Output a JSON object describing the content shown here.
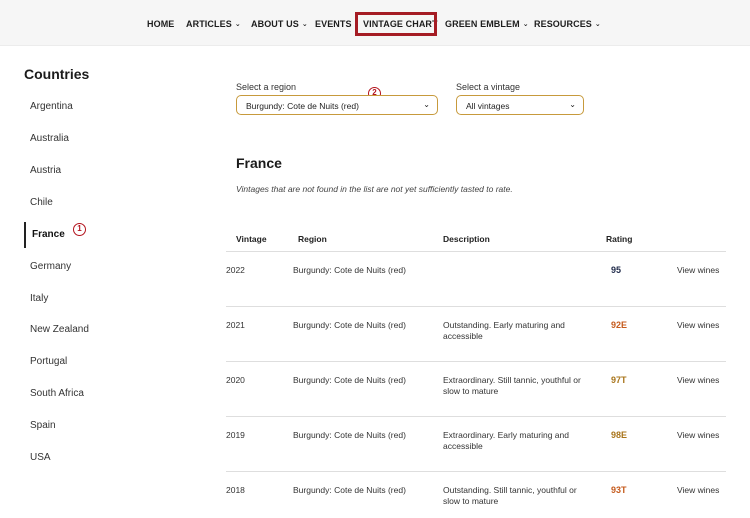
{
  "nav": {
    "items": [
      {
        "label": "HOME",
        "dropdown": false
      },
      {
        "label": "ARTICLES",
        "dropdown": true
      },
      {
        "label": "ABOUT US",
        "dropdown": true
      },
      {
        "label": "EVENTS",
        "dropdown": false
      },
      {
        "label": "VINTAGE CHART",
        "dropdown": false
      },
      {
        "label": "GREEN EMBLEM",
        "dropdown": true
      },
      {
        "label": "RESOURCES",
        "dropdown": true
      }
    ],
    "highlight_color": "#a51c24"
  },
  "sidebar": {
    "title": "Countries",
    "items": [
      "Argentina",
      "Australia",
      "Austria",
      "Chile",
      "France",
      "Germany",
      "Italy",
      "New Zealand",
      "Portugal",
      "South Africa",
      "Spain",
      "USA"
    ],
    "active": "France"
  },
  "markers": {
    "one": "1",
    "two": "2"
  },
  "filters": {
    "region_label": "Select a region",
    "region_value": "Burgundy: Cote de Nuits (red)",
    "vintage_label": "Select a vintage",
    "vintage_value": "All vintages"
  },
  "content": {
    "heading": "France",
    "note": "Vintages that are not found in the list are not yet sufficiently tasted to rate."
  },
  "table": {
    "headers": [
      "Vintage",
      "Region",
      "Description",
      "Rating"
    ],
    "rows": [
      {
        "vintage": "2022",
        "region": "Burgundy: Cote de Nuits (red)",
        "description": "",
        "rating": "95",
        "rating_color": "#1f2a4a",
        "link": "View wines"
      },
      {
        "vintage": "2021",
        "region": "Burgundy: Cote de Nuits (red)",
        "description": "Outstanding. Early maturing and accessible",
        "rating": "92E",
        "rating_color": "#c55a1c",
        "link": "View wines"
      },
      {
        "vintage": "2020",
        "region": "Burgundy: Cote de Nuits (red)",
        "description": "Extraordinary. Still tannic, youthful or slow to mature",
        "rating": "97T",
        "rating_color": "#a8741a",
        "link": "View wines"
      },
      {
        "vintage": "2019",
        "region": "Burgundy: Cote de Nuits (red)",
        "description": "Extraordinary. Early maturing and accessible",
        "rating": "98E",
        "rating_color": "#a8741a",
        "link": "View wines"
      },
      {
        "vintage": "2018",
        "region": "Burgundy: Cote de Nuits (red)",
        "description": "Outstanding. Still tannic, youthful or slow to mature",
        "rating": "93T",
        "rating_color": "#c55a1c",
        "link": "View wines"
      }
    ]
  }
}
